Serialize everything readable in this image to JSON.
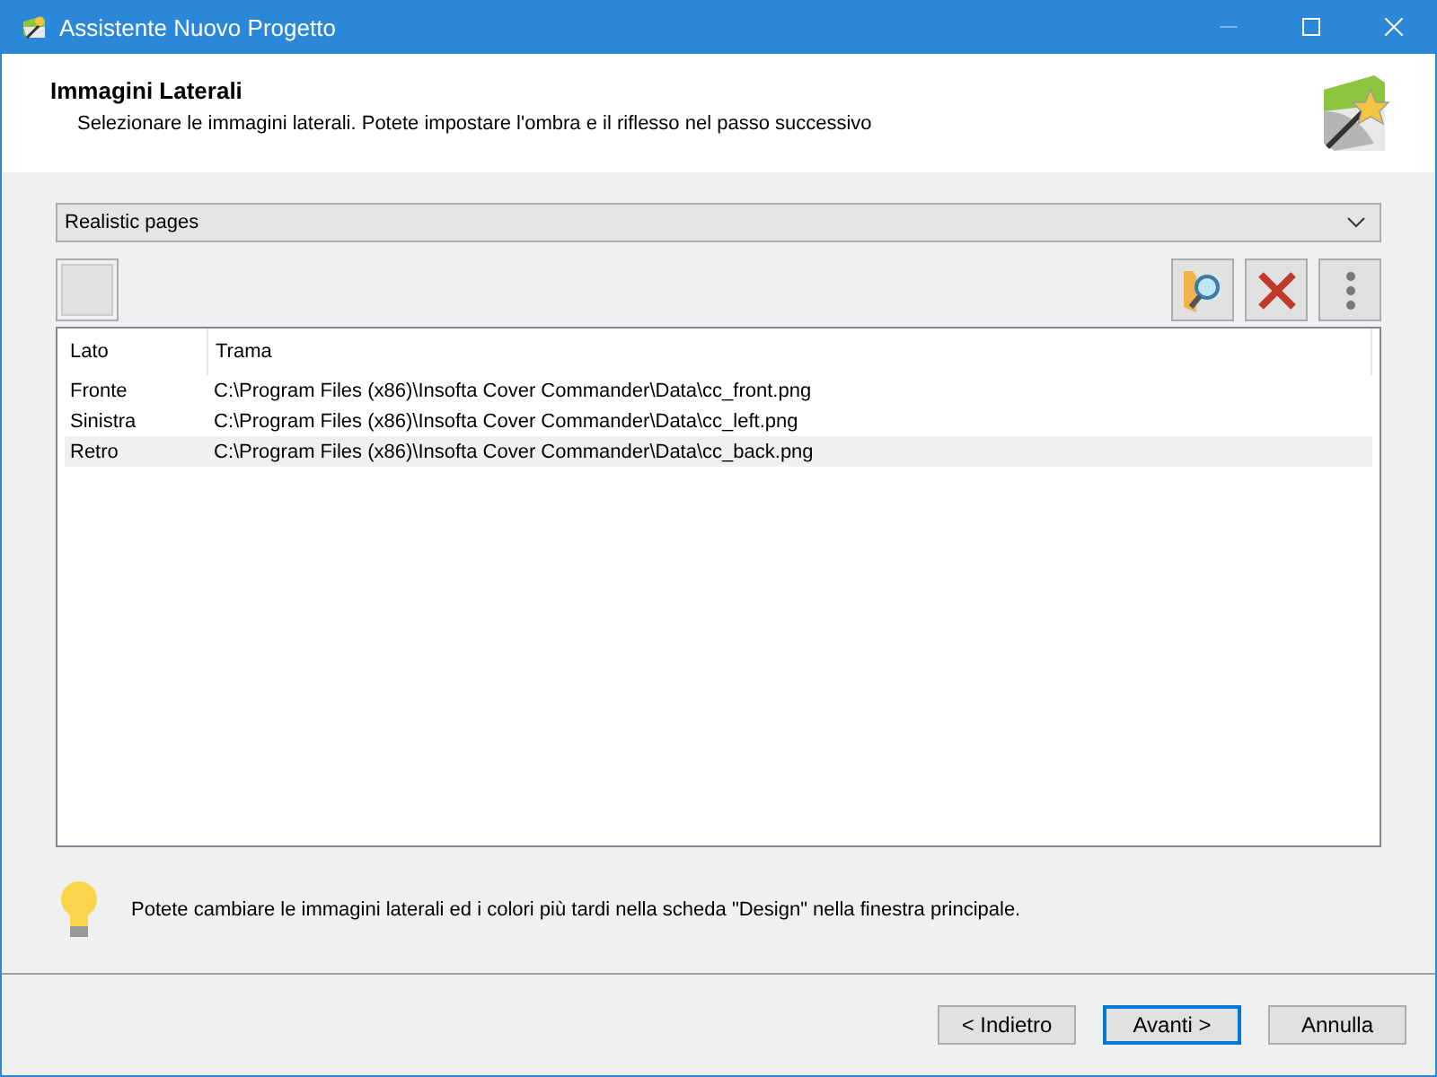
{
  "window": {
    "title": "Assistente Nuovo Progetto"
  },
  "header": {
    "title": "Immagini Laterali",
    "subtitle": "Selezionare le immagini laterali. Potete impostare l'ombra e il riflesso nel passo successivo"
  },
  "preset_dropdown": {
    "value": "Realistic pages"
  },
  "table": {
    "columns": [
      "Lato",
      "Trama"
    ],
    "rows": [
      {
        "cells": [
          "Fronte",
          "C:\\Program Files (x86)\\Insofta Cover Commander\\Data\\cc_front.png"
        ],
        "selected": false
      },
      {
        "cells": [
          "Sinistra",
          "C:\\Program Files (x86)\\Insofta Cover Commander\\Data\\cc_left.png"
        ],
        "selected": false
      },
      {
        "cells": [
          "Retro",
          "C:\\Program Files (x86)\\Insofta Cover Commander\\Data\\cc_back.png"
        ],
        "selected": true
      }
    ]
  },
  "tip": "Potete cambiare le immagini laterali ed i colori più tardi nella scheda \"Design\" nella finestra principale.",
  "buttons": [
    {
      "label": "< Indietro",
      "default": false
    },
    {
      "label": "Avanti >",
      "default": true
    },
    {
      "label": "Annulla",
      "default": false
    }
  ]
}
